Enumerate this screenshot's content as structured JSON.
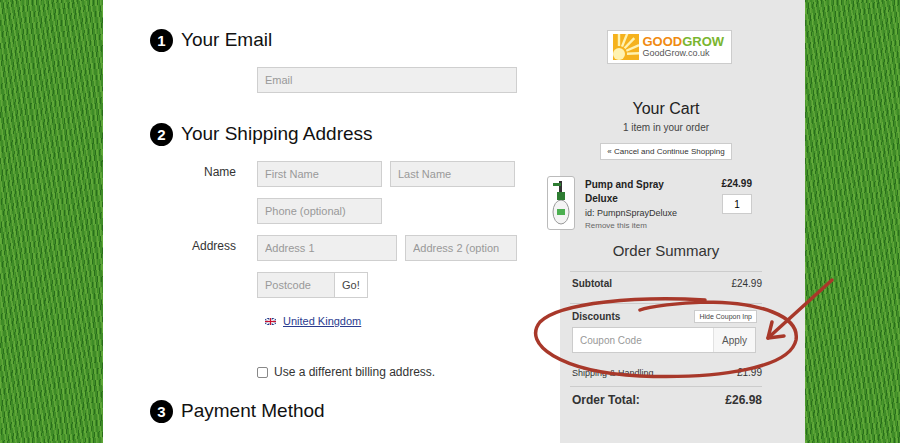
{
  "email": {
    "step": "1",
    "title": "Your Email",
    "placeholder": "Email"
  },
  "shipping": {
    "step": "2",
    "title": "Your Shipping Address",
    "name_label": "Name",
    "first_name": "First Name",
    "last_name": "Last Name",
    "phone": "Phone (optional)",
    "address_label": "Address",
    "address1": "Address 1",
    "address2": "Address 2 (option",
    "postcode": "Postcode",
    "go_button": "Go!",
    "country": "United Kingdom",
    "billing": {
      "label": "Use a different billing address.",
      "checked": false
    }
  },
  "payment": {
    "step": "3",
    "title": "Payment Method"
  },
  "logo": {
    "brand_left": "GOOD",
    "brand_right": "GROW",
    "url": "GoodGrow.co.uk"
  },
  "cart": {
    "title": "Your Cart",
    "count": "1 item in your order",
    "cancel_button": "« Cancel and Continue Shopping",
    "items": [
      {
        "name": "Pump and Spray Deluxe",
        "id": "id: PumpnSprayDeluxe",
        "remove": "Remove this item",
        "price": "£24.99",
        "qty": "1"
      }
    ]
  },
  "summary": {
    "title": "Order Summary",
    "subtotal_label": "Subtotal",
    "subtotal": "£24.99",
    "discounts_label": "Discounts",
    "hide_coupon_button": "Hide Coupon Inp",
    "coupon_placeholder": "Coupon Code",
    "apply_button": "Apply",
    "shipping_label": "Shipping & Handling",
    "shipping": "£1.99",
    "total_label": "Order Total:",
    "total": "£26.98"
  }
}
